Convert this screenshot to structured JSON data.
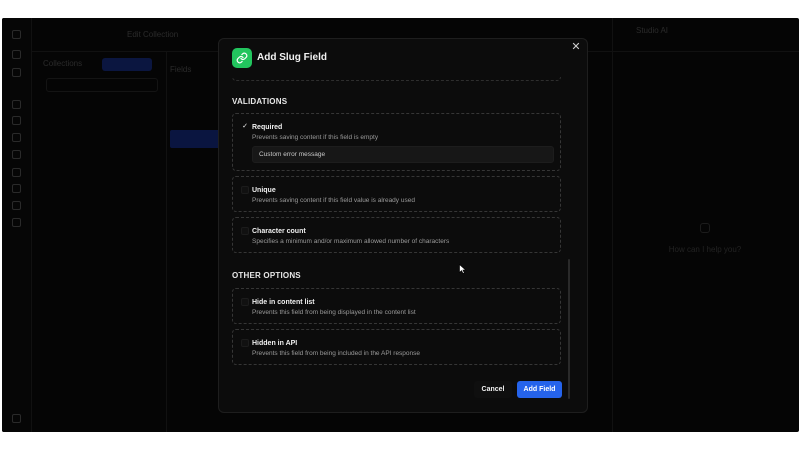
{
  "colors": {
    "accent": "#2563eb",
    "slug_icon": "#22c55e",
    "modal_bg": "#0c0c0c",
    "page_bg": "#050505"
  },
  "modal": {
    "icon": "link-icon",
    "title": "Add Slug Field",
    "close_icon": "close-icon"
  },
  "validations": {
    "title": "VALIDATIONS",
    "required": {
      "label": "Required",
      "description": "Prevents saving content if this field is empty",
      "checked": true,
      "error_message_value": "Custom error message"
    },
    "unique": {
      "label": "Unique",
      "description": "Prevents saving content if this field value is already used",
      "checked": false
    },
    "character_count": {
      "label": "Character count",
      "description": "Specifies a minimum and/or maximum allowed number of characters",
      "checked": false
    }
  },
  "other_options": {
    "title": "OTHER OPTIONS",
    "hide_in_content_list": {
      "label": "Hide in content list",
      "description": "Prevents this field from being displayed in the content list",
      "checked": false
    },
    "hidden_in_api": {
      "label": "Hidden in API",
      "description": "Prevents this field from being included in the API response",
      "checked": false
    }
  },
  "footer": {
    "cancel_label": "Cancel",
    "add_label": "Add Field"
  },
  "background": {
    "breadcrumb": "Edit Collection",
    "collections_label": "Collections",
    "fields_label": "Fields",
    "assistant_label": "Studio AI",
    "help_title": "How can I help you?"
  }
}
